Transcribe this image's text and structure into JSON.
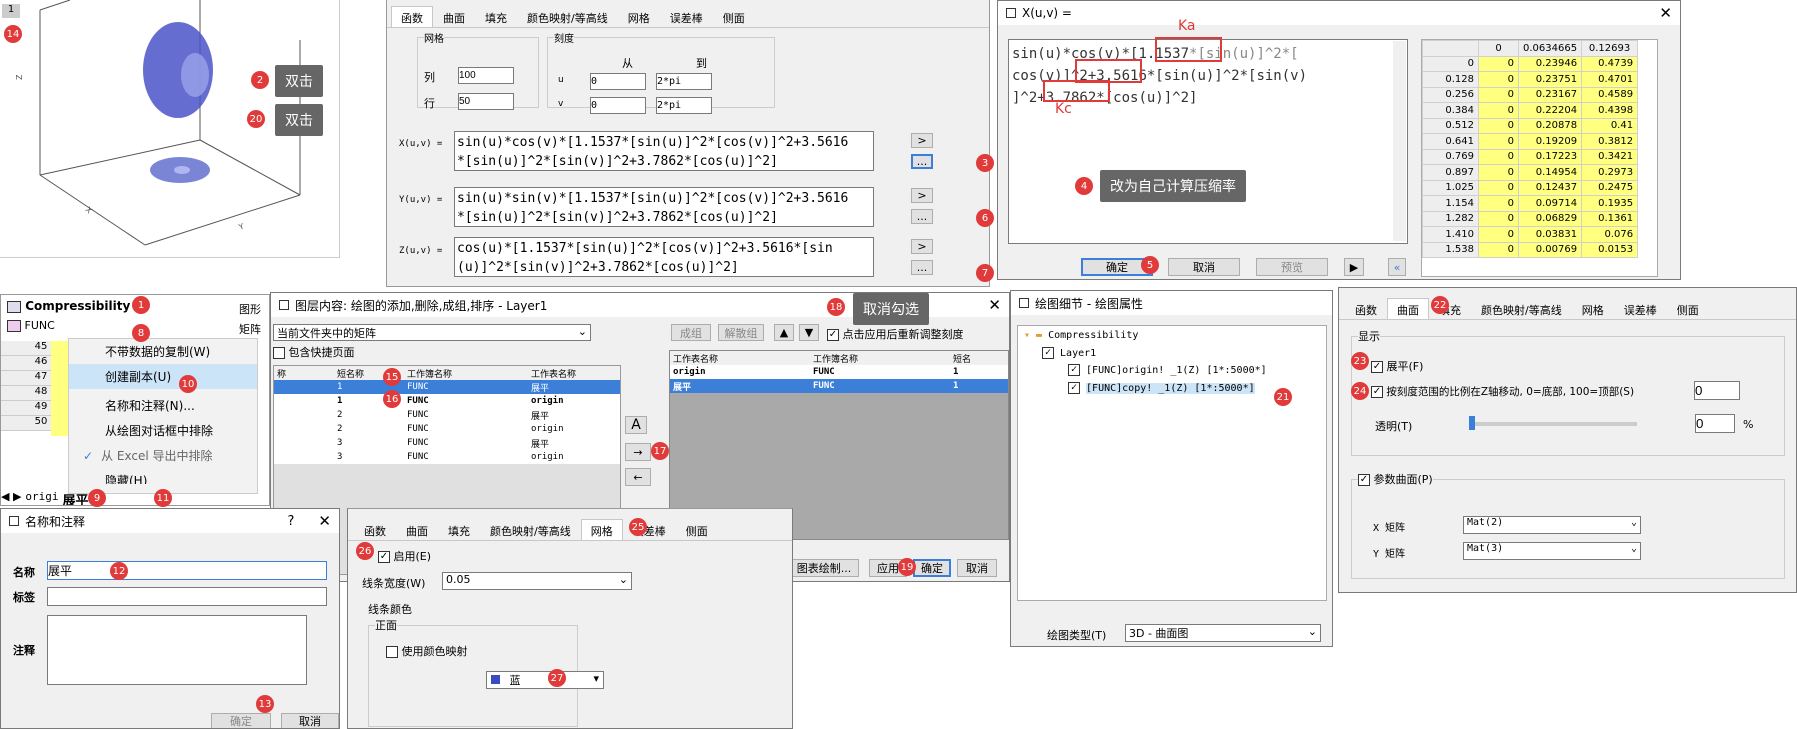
{
  "graph": {
    "page_num": "1"
  },
  "tabs_main": [
    "函数",
    "曲面",
    "填充",
    "颜色映射/等高线",
    "网格",
    "误差棒",
    "侧面"
  ],
  "grid_group": {
    "title": "网格",
    "col_label": "列",
    "col_value": "100",
    "row_label": "行",
    "row_value": "50"
  },
  "scale_group": {
    "title": "刻度",
    "from": "从",
    "to": "到",
    "u": "u",
    "u_from": "0",
    "u_to": "2*pi",
    "v": "v",
    "v_from": "0",
    "v_to": "2*pi"
  },
  "funcs": {
    "x_label": "X(u,v) =",
    "x_expr": "sin(u)*cos(v)*[1.1537*[sin(u)]^2*[cos(v)]^2+3.5616*[sin(u)]^2*[sin(v)]^2+3.7862*[cos(u)]^2]",
    "y_label": "Y(u,v) =",
    "y_expr": "sin(u)*sin(v)*[1.1537*[sin(u)]^2*[cos(v)]^2+3.5616*[sin(u)]^2*[sin(v)]^2+3.7862*[cos(u)]^2]",
    "z_label": "Z(u,v) =",
    "z_expr": "cos(u)*[1.1537*[sin(u)]^2*[cos(v)]^2+3.5616*[sin(u)]^2*[sin(v)]^2+3.7862*[cos(u)]^2]",
    "arrow": ">",
    "ellipsis": "..."
  },
  "xuv": {
    "title": "X(u,v) =",
    "ka": "Ka",
    "kc": "Kc",
    "line1_a": "sin(u)*cos(v)*[",
    "line1_ka": "1.1537",
    "line1_b": "*[sin(u)]^2*[",
    "line2_a": "cos(v)]^2+",
    "line2_kb": "3.5616",
    "line2_b": "*[sin(u)]^2*[sin(v)",
    "line3_a": "]^2+",
    "line3_kc": "3.7862",
    "line3_b": "*[cos(u)]^2]",
    "ok": "确定",
    "cancel": "取消",
    "preview": "预览",
    "play": "▶",
    "collapse": "«",
    "headers": [
      "0",
      "0.0634665",
      "0.12693"
    ],
    "rows": [
      [
        "0",
        "0",
        "0.4739"
      ],
      [
        "0.128",
        "0",
        "0.23751",
        "0.4701"
      ],
      [
        "0.256",
        "0",
        "0.23167",
        "0.4589"
      ],
      [
        "0.384",
        "0",
        "0.22204",
        "0.4398"
      ],
      [
        "0.512",
        "0",
        "0.20878",
        "0.41"
      ],
      [
        "0.641",
        "0",
        "0.19209",
        "0.3812"
      ],
      [
        "0.769",
        "0",
        "0.17223",
        "0.3421"
      ],
      [
        "0.897",
        "0",
        "0.14954",
        "0.2973"
      ],
      [
        "1.025",
        "0",
        "0.12437",
        "0.2475"
      ],
      [
        "1.154",
        "0",
        "0.09714",
        "0.1935"
      ],
      [
        "1.282",
        "0",
        "0.06829",
        "0.1361"
      ],
      [
        "1.410",
        "0",
        "0.03831",
        "0.076"
      ],
      [
        "1.538",
        "0",
        "0.00769",
        "0.0153"
      ]
    ],
    "row0_val": "0.23946"
  },
  "callouts": {
    "c2": "双击",
    "c20": "双击",
    "c4": "改为自己计算压缩率",
    "c18": "取消勾选"
  },
  "project": {
    "item1": "Compressibility",
    "item1_kind": "图形",
    "item2": "FUNC",
    "item2_kind": "矩阵"
  },
  "rows_left": [
    "45",
    "46",
    "47",
    "48",
    "49",
    "50"
  ],
  "ctx": {
    "i1": "不带数据的复制(W)",
    "i2": "创建副本(U)",
    "i3": "名称和注释(N)...",
    "i4": "从绘图对话框中排除",
    "i5": "从 Excel 导出中排除",
    "i6": "隐藏(H)"
  },
  "sheettabs": {
    "t1": "origi",
    "t2": "展平"
  },
  "layer_dlg": {
    "title": "图层内容: 绘图的添加,删除,成组,排序 - Layer1",
    "source": "当前文件夹中的矩阵",
    "include": "包含快捷页面",
    "cols": [
      "称",
      "短名称",
      "工作簿名称",
      "工作表名称"
    ],
    "rows": [
      [
        "",
        "1",
        "FUNC",
        "展平"
      ],
      [
        "",
        "1",
        "FUNC",
        "origin"
      ],
      [
        "",
        "2",
        "FUNC",
        "展平"
      ],
      [
        "",
        "2",
        "FUNC",
        "origin"
      ],
      [
        "",
        "3",
        "FUNC",
        "展平"
      ],
      [
        "",
        "3",
        "FUNC",
        "origin"
      ]
    ],
    "group": "成组",
    "ungroup": "解散组",
    "autoscale": "点击应用后重新调整刻度",
    "rcols": [
      "工作表名称",
      "工作簿名称",
      "短名"
    ],
    "rrows": [
      [
        "origin",
        "FUNC",
        "1"
      ],
      [
        "展平",
        "FUNC",
        "1"
      ]
    ],
    "plotset": "图表绘制...",
    "apply": "应用",
    "ok": "确定",
    "cancel": "取消"
  },
  "name_dlg": {
    "title": "名称和注释",
    "help": "?",
    "name_label": "名称",
    "name_value": "展平",
    "tag_label": "标签",
    "note_label": "注释",
    "ok": "确定",
    "cancel": "取消"
  },
  "mesh_dlg": {
    "tabs": [
      "函数",
      "曲面",
      "填充",
      "颜色映射/等高线",
      "网格",
      "误差棒",
      "侧面"
    ],
    "enable": "启用(E)",
    "width_label": "线条宽度(W)",
    "width_value": "0.05",
    "color_group": "线条颜色",
    "front": "正面",
    "use_cmap": "使用颜色映射",
    "color": "蓝"
  },
  "plot_detail": {
    "title": "绘图细节 - 绘图属性",
    "tree1": "Compressibility",
    "tree2": "Layer1",
    "tree3": "[FUNC]origin! _1(Z) [1*:5000*]",
    "tree4": "[FUNC]copy! _1(Z) [1*:5000*]",
    "type_label": "绘图类型(T)",
    "type_value": "3D - 曲面图"
  },
  "surface_dlg": {
    "tabs": [
      "函数",
      "曲面",
      "填充",
      "颜色映射/等高线",
      "网格",
      "误差棒",
      "侧面"
    ],
    "group": "显示",
    "flat": "展平(F)",
    "move": "按刻度范围的比例在Z轴移动, 0=底部, 100=顶部(S)",
    "move_val": "0",
    "trans": "透明(T)",
    "trans_val": "0",
    "pct": "%",
    "param": "参数曲面(P)",
    "xm_label": "X 矩阵",
    "xm_val": "Mat(2)",
    "ym_label": "Y 矩阵",
    "ym_val": "Mat(3)"
  },
  "badges": [
    "1",
    "2",
    "3",
    "4",
    "5",
    "6",
    "7",
    "8",
    "9",
    "10",
    "11",
    "12",
    "13",
    "14",
    "15",
    "16",
    "17",
    "18",
    "19",
    "20",
    "21",
    "22",
    "23",
    "24",
    "25",
    "26",
    "27"
  ],
  "colors": {
    "badge": "#e03a3a",
    "surface": "#3a4bbf",
    "highlight": "#ffff80",
    "select": "#3c7fd8"
  }
}
